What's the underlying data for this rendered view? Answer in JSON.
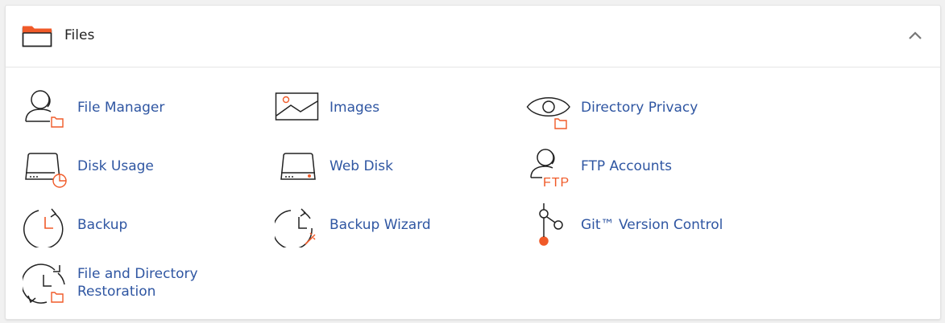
{
  "section": {
    "title": "Files",
    "folder_icon": "folder-icon",
    "collapse_icon": "chevron-up-icon"
  },
  "colors": {
    "link": "#2f56a2",
    "accent": "#f05a28",
    "icon_stroke": "#222222"
  },
  "items": [
    {
      "label": "File Manager",
      "icon": "file-manager-icon"
    },
    {
      "label": "Images",
      "icon": "images-icon"
    },
    {
      "label": "Directory Privacy",
      "icon": "directory-privacy-icon"
    },
    {
      "label": "Disk Usage",
      "icon": "disk-usage-icon"
    },
    {
      "label": "Web Disk",
      "icon": "web-disk-icon"
    },
    {
      "label": "FTP Accounts",
      "icon": "ftp-accounts-icon",
      "icon_text": "FTP"
    },
    {
      "label": "Backup",
      "icon": "backup-icon"
    },
    {
      "label": "Backup Wizard",
      "icon": "backup-wizard-icon"
    },
    {
      "label": "Git™ Version Control",
      "icon": "git-icon"
    },
    {
      "label": "File and Directory Restoration",
      "icon": "file-restoration-icon"
    }
  ]
}
